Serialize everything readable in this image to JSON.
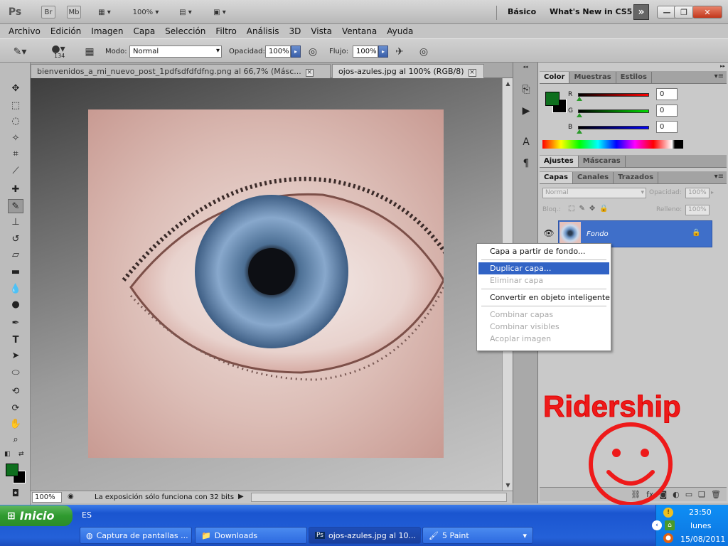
{
  "appbar": {
    "workspace_basico": "Básico",
    "workspace_new": "What's New in CS5",
    "zoom_value": "100%",
    "mb_label": "Mb",
    "br_label": "Br"
  },
  "menu": [
    "Archivo",
    "Edición",
    "Imagen",
    "Capa",
    "Selección",
    "Filtro",
    "Análisis",
    "3D",
    "Vista",
    "Ventana",
    "Ayuda"
  ],
  "options": {
    "brush_size": "134",
    "modo_label": "Modo:",
    "modo_value": "Normal",
    "opacidad_label": "Opacidad:",
    "opacidad_value": "100%",
    "flujo_label": "Flujo:",
    "flujo_value": "100%"
  },
  "tabs": [
    {
      "label": "bienvenidos_a_mi_nuevo_post_1pdfsdfdfdfng.png al 66,7% (Másc..."
    },
    {
      "label": "ojos-azules.jpg al 100% (RGB/8)"
    }
  ],
  "status": {
    "zoom": "100%",
    "text": "La exposición sólo funciona con 32 bits"
  },
  "color_panel": {
    "tabs": [
      "Color",
      "Muestras",
      "Estilos"
    ],
    "r_label": "R",
    "g_label": "G",
    "b_label": "B",
    "r_value": "0",
    "g_value": "0",
    "b_value": "0"
  },
  "adjust_panel": {
    "tabs": [
      "Ajustes",
      "Máscaras"
    ]
  },
  "layers_panel": {
    "tabs": [
      "Capas",
      "Canales",
      "Trazados"
    ],
    "blend_mode": "Normal",
    "opacidad_label": "Opacidad:",
    "opacidad_value": "100%",
    "bloq_label": "Bloq.:",
    "relleno_label": "Relleno:",
    "relleno_value": "100%",
    "layer_name": "Fondo"
  },
  "context_menu": {
    "items": [
      {
        "label": "Capa a partir de fondo...",
        "state": "normal"
      },
      {
        "label": "Duplicar capa...",
        "state": "hover"
      },
      {
        "label": "Eliminar capa",
        "state": "disabled"
      },
      {
        "label": "Convertir en objeto inteligente",
        "state": "normal"
      },
      {
        "label": "Combinar capas",
        "state": "disabled"
      },
      {
        "label": "Combinar visibles",
        "state": "disabled"
      },
      {
        "label": "Acoplar imagen",
        "state": "disabled"
      }
    ]
  },
  "overlay_text": "Ridership",
  "taskbar": {
    "start_label": "Inicio",
    "lang": "ES",
    "tasks": [
      {
        "label": "Captura de pantallas ..."
      },
      {
        "label": "Downloads"
      },
      {
        "label": "ojos-azules.jpg al 10..."
      },
      {
        "label": "5 Paint"
      }
    ],
    "time": "23:50",
    "day": "lunes",
    "date": "15/08/2011"
  },
  "colors": {
    "foreground": "#0e6f1e",
    "background": "#000000",
    "selection": "#3163c5",
    "overlay": "#ee1a1a"
  }
}
